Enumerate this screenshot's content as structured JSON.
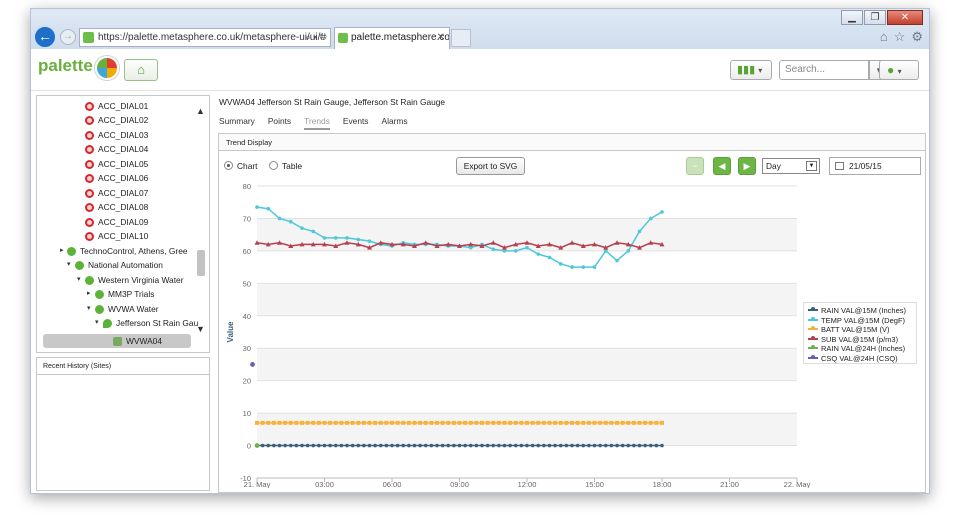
{
  "browser": {
    "url": "https://palette.metasphere.co.uk/metasphere-ui/ui/#",
    "tab_title": "palette.metasphere.co.uk",
    "win_minimize": "▁",
    "win_restore": "❐",
    "win_close": "✕"
  },
  "app": {
    "logo_text": "palette",
    "search_placeholder": "Search..."
  },
  "tree": {
    "items": [
      {
        "label": "ACC_DIAL01"
      },
      {
        "label": "ACC_DIAL02"
      },
      {
        "label": "ACC_DIAL03"
      },
      {
        "label": "ACC_DIAL04"
      },
      {
        "label": "ACC_DIAL05"
      },
      {
        "label": "ACC_DIAL06"
      },
      {
        "label": "ACC_DIAL07"
      },
      {
        "label": "ACC_DIAL08"
      },
      {
        "label": "ACC_DIAL09"
      },
      {
        "label": "ACC_DIAL10"
      }
    ],
    "groups": [
      {
        "label": "TechnoControl, Athens, Gree"
      },
      {
        "label": "National Automation"
      },
      {
        "label": "Western Virginia Water"
      },
      {
        "label": "MM3P Trials"
      },
      {
        "label": "WVWA Water"
      },
      {
        "label": "Jefferson St Rain Gau"
      },
      {
        "label": "WVWA04"
      }
    ]
  },
  "recent": {
    "title": "Recent History (Sites)"
  },
  "site": {
    "title": "WVWA04 Jefferson St Rain Gauge, Jefferson St Rain Gauge",
    "tabs": [
      "Summary",
      "Points",
      "Trends",
      "Events",
      "Alarms"
    ]
  },
  "trend": {
    "panel_title": "Trend Display",
    "chart_option": "Chart",
    "table_option": "Table",
    "export_label": "Export to SVG",
    "period": "Day",
    "date": "21/05/15"
  },
  "chart_data": {
    "type": "line",
    "xlabel": "",
    "ylabel": "Value",
    "ylim": [
      -10,
      80
    ],
    "yticks": [
      -10,
      0,
      10,
      20,
      30,
      40,
      50,
      60,
      70,
      80
    ],
    "xticks": [
      "21. May",
      "03:00",
      "06:00",
      "09:00",
      "12:00",
      "15:00",
      "18:00",
      "21:00",
      "22. May"
    ],
    "legend_position": "right",
    "series": [
      {
        "name": "RAIN VAL@15M (Inches)",
        "color": "#3b5f7d",
        "x": [
          0,
          18
        ],
        "values": [
          0,
          0
        ]
      },
      {
        "name": "TEMP VAL@15M (DegF)",
        "color": "#4ec8d9",
        "x": [
          0,
          0.5,
          1,
          1.5,
          2,
          2.5,
          3,
          3.5,
          4,
          4.5,
          5,
          5.5,
          6,
          6.5,
          7,
          7.5,
          8,
          8.5,
          9,
          9.5,
          10,
          10.5,
          11,
          11.5,
          12,
          12.5,
          13,
          13.5,
          14,
          14.5,
          15,
          15.5,
          16,
          16.5,
          17,
          17.5,
          18
        ],
        "values": [
          73.5,
          73,
          70,
          69,
          67,
          66,
          64,
          64,
          64,
          63.5,
          63,
          62,
          61.5,
          62.5,
          62,
          62,
          62,
          61.5,
          61.5,
          61,
          62,
          60.5,
          60,
          60,
          61,
          59,
          58,
          56,
          55,
          55,
          55,
          60,
          57,
          60,
          66,
          70,
          72
        ]
      },
      {
        "name": "BATT VAL@15M (V)",
        "color": "#f6b23c",
        "x": [
          0,
          18
        ],
        "values": [
          7,
          7
        ]
      },
      {
        "name": "SUB VAL@15M (p/m3)",
        "color": "#b5404f",
        "x": [
          0,
          0.5,
          1,
          1.5,
          2,
          2.5,
          3,
          3.5,
          4,
          4.5,
          5,
          5.5,
          6,
          6.5,
          7,
          7.5,
          8,
          8.5,
          9,
          9.5,
          10,
          10.5,
          11,
          11.5,
          12,
          12.5,
          13,
          13.5,
          14,
          14.5,
          15,
          15.5,
          16,
          16.5,
          17,
          17.5,
          18
        ],
        "values": [
          62.5,
          62,
          62.5,
          61.5,
          62,
          62,
          62,
          61.5,
          62.5,
          62,
          61,
          62.5,
          62,
          62,
          61.5,
          62.5,
          61.5,
          62,
          61.5,
          62,
          61.5,
          62.5,
          61,
          62,
          62.5,
          61.5,
          62,
          61,
          62.5,
          61.5,
          62,
          61,
          62.5,
          62,
          61,
          62.5,
          62
        ]
      },
      {
        "name": "RAIN VAL@24H (Inches)",
        "color": "#6fb24a",
        "x": [
          0
        ],
        "values": [
          0
        ]
      },
      {
        "name": "CSQ VAL@24H (CSQ)",
        "color": "#6a5fb8",
        "x": [
          -0.2
        ],
        "values": [
          25
        ]
      }
    ]
  }
}
